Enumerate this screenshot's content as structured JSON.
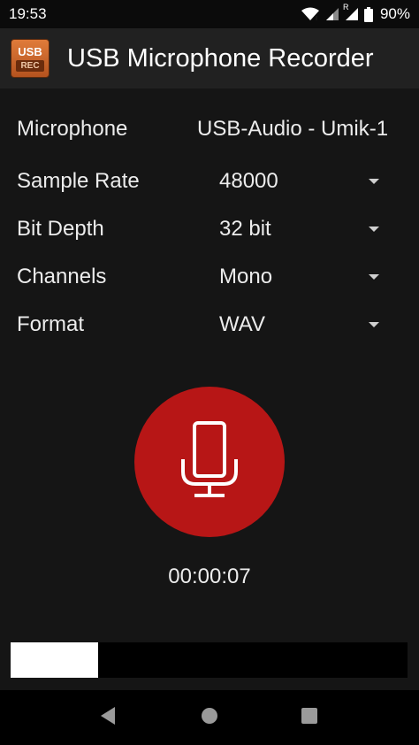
{
  "status_bar": {
    "time": "19:53",
    "roaming_indicator": "R",
    "battery_percent": "90%",
    "icons": [
      "wifi-icon",
      "signal-icon",
      "signal-roaming-icon",
      "battery-icon"
    ]
  },
  "app_bar": {
    "icon_top": "USB",
    "icon_bottom": "REC",
    "title": "USB Microphone Recorder"
  },
  "settings": {
    "microphone": {
      "label": "Microphone",
      "value": "USB-Audio - Umik-1"
    },
    "sample_rate": {
      "label": "Sample Rate",
      "value": "48000"
    },
    "bit_depth": {
      "label": "Bit Depth",
      "value": "32 bit"
    },
    "channels": {
      "label": "Channels",
      "value": "Mono"
    },
    "format": {
      "label": "Format",
      "value": "WAV"
    }
  },
  "record": {
    "icon": "microphone-icon",
    "timer": "00:00:07"
  },
  "level_meter": {
    "level": 0.22
  },
  "nav_bar": {
    "icons": [
      "back-icon",
      "home-icon",
      "recents-icon"
    ]
  },
  "colors": {
    "record_button": "#b71616",
    "background": "#151515",
    "app_bar": "#212121",
    "level_fill": "#ffffff"
  }
}
